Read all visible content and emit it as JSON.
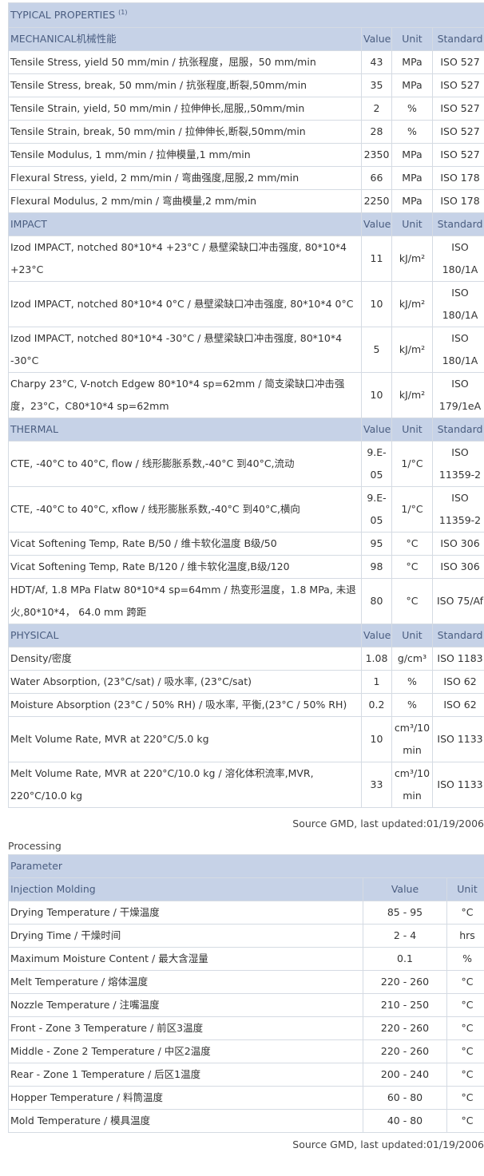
{
  "properties": {
    "title": "TYPICAL PROPERTIES",
    "title_sup": "(1)",
    "col_value": "Value",
    "col_unit": "Unit",
    "col_standard": "Standard",
    "sections": [
      {
        "name": "MECHANICAL机械性能",
        "rows": [
          {
            "prop": "Tensile Stress, yield 50 mm/min / 抗张程度，屈服，50 mm/min",
            "value": "43",
            "unit": "MPa",
            "standard": "ISO 527"
          },
          {
            "prop": "Tensile Stress, break, 50 mm/min / 抗张程度,断裂,50mm/min",
            "value": "35",
            "unit": "MPa",
            "standard": "ISO 527"
          },
          {
            "prop": "Tensile Strain, yield, 50 mm/min / 拉伸伸长,屈服,,50mm/min",
            "value": "2",
            "unit": "%",
            "standard": "ISO 527"
          },
          {
            "prop": "Tensile Strain, break, 50 mm/min / 拉伸伸长,断裂,50mm/min",
            "value": "28",
            "unit": "%",
            "standard": "ISO 527"
          },
          {
            "prop": "Tensile Modulus, 1 mm/min / 拉伸模量,1 mm/min",
            "value": "2350",
            "unit": "MPa",
            "standard": "ISO 527"
          },
          {
            "prop": "Flexural Stress, yield, 2 mm/min / 弯曲强度,屈服,2 mm/min",
            "value": "66",
            "unit": "MPa",
            "standard": "ISO 178"
          },
          {
            "prop": "Flexural Modulus, 2 mm/min / 弯曲模量,2 mm/min",
            "value": "2250",
            "unit": "MPa",
            "standard": "ISO 178"
          }
        ]
      },
      {
        "name": "IMPACT",
        "rows": [
          {
            "prop": "Izod IMPACT, notched 80*10*4 +23°C / 悬壁梁缺口冲击强度, 80*10*4 +23°C",
            "value": "11",
            "unit": "kJ/m²",
            "standard": "ISO 180/1A"
          },
          {
            "prop": "Izod IMPACT, notched 80*10*4 0°C / 悬壁梁缺口冲击强度, 80*10*4 0°C",
            "value": "10",
            "unit": "kJ/m²",
            "standard": "ISO 180/1A"
          },
          {
            "prop": "Izod IMPACT, notched 80*10*4 -30°C / 悬壁梁缺口冲击强度, 80*10*4 -30°C",
            "value": "5",
            "unit": "kJ/m²",
            "standard": "ISO 180/1A"
          },
          {
            "prop": "Charpy 23°C, V-notch Edgew 80*10*4 sp=62mm / 简支梁缺口冲击强度，23°C，C80*10*4 sp=62mm",
            "value": "10",
            "unit": "kJ/m²",
            "standard": "ISO 179/1eA"
          }
        ]
      },
      {
        "name": "THERMAL",
        "rows": [
          {
            "prop": "CTE, -40°C to 40°C, flow / 线形膨胀系数,-40°C 到40°C,流动",
            "value": "9.E-05",
            "unit": "1/°C",
            "standard": "ISO 11359-2"
          },
          {
            "prop": "CTE, -40°C to 40°C, xflow / 线形膨胀系数,-40°C 到40°C,横向",
            "value": "9.E-05",
            "unit": "1/°C",
            "standard": "ISO 11359-2"
          },
          {
            "prop": "Vicat Softening Temp, Rate B/50 / 维卡软化温度 B级/50",
            "value": "95",
            "unit": "°C",
            "standard": "ISO 306"
          },
          {
            "prop": "Vicat Softening Temp, Rate B/120 / 维卡软化温度,B级/120",
            "value": "98",
            "unit": "°C",
            "standard": "ISO 306"
          },
          {
            "prop": "HDT/Af, 1.8 MPa Flatw 80*10*4 sp=64mm / 热变形温度，1.8 MPa, 未退火,80*10*4， 64.0 mm 跨距",
            "value": "80",
            "unit": "°C",
            "standard": "ISO 75/Af"
          }
        ]
      },
      {
        "name": "PHYSICAL",
        "rows": [
          {
            "prop": "Density/密度",
            "value": "1.08",
            "unit": "g/cm³",
            "standard": "ISO 1183"
          },
          {
            "prop": "Water Absorption, (23°C/sat) / 吸水率, (23°C/sat)",
            "value": "1",
            "unit": "%",
            "standard": "ISO 62"
          },
          {
            "prop": "Moisture Absorption (23°C / 50% RH) / 吸水率, 平衡,(23°C / 50% RH)",
            "value": "0.2",
            "unit": "%",
            "standard": "ISO 62"
          },
          {
            "prop": "Melt Volume Rate, MVR at 220°C/5.0 kg",
            "value": "10",
            "unit": "cm³/10 min",
            "standard": "ISO 1133"
          },
          {
            "prop": "Melt Volume Rate, MVR at 220°C/10.0 kg / 溶化体积流率,MVR, 220°C/10.0 kg",
            "value": "33",
            "unit": "cm³/10 min",
            "standard": "ISO 1133"
          }
        ]
      }
    ],
    "source": "Source GMD, last updated:01/19/2006"
  },
  "processing": {
    "label": "Processing",
    "param_header": "Parameter",
    "section": "Injection Molding",
    "col_value": "Value",
    "col_unit": "Unit",
    "rows": [
      {
        "param": "Drying Temperature / 干燥温度",
        "value": "85 - 95",
        "unit": "°C"
      },
      {
        "param": "Drying Time / 干燥时间",
        "value": "2 - 4",
        "unit": "hrs"
      },
      {
        "param": "Maximum Moisture Content / 最大含湿量",
        "value": "0.1",
        "unit": "%"
      },
      {
        "param": "Melt Temperature / 熔体温度",
        "value": "220 - 260",
        "unit": "°C"
      },
      {
        "param": "Nozzle Temperature / 注嘴温度",
        "value": "210 - 250",
        "unit": "°C"
      },
      {
        "param": "Front - Zone 3 Temperature / 前区3温度",
        "value": "220 - 260",
        "unit": "°C"
      },
      {
        "param": "Middle - Zone 2 Temperature / 中区2温度",
        "value": "220 - 260",
        "unit": "°C"
      },
      {
        "param": "Rear - Zone 1 Temperature / 后区1温度",
        "value": "200 - 240",
        "unit": "°C"
      },
      {
        "param": "Hopper Temperature / 料筒温度",
        "value": "60 - 80",
        "unit": "°C"
      },
      {
        "param": "Mold Temperature / 模具温度",
        "value": "40 - 80",
        "unit": "°C"
      }
    ],
    "source": "Source GMD, last updated:01/19/2006"
  }
}
